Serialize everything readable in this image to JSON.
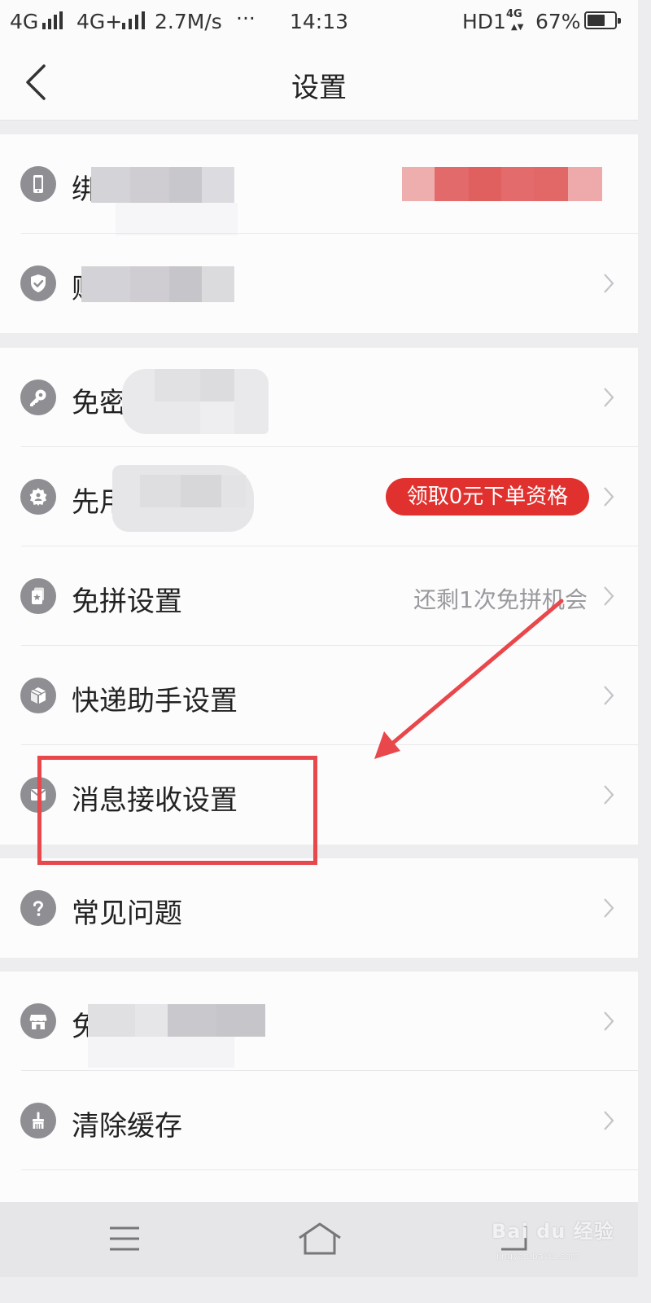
{
  "status_bar": {
    "carrier1": "4G",
    "carrier2": "4G+",
    "speed": "2.7M/s",
    "more": "···",
    "time": "14:13",
    "hd": "HD1",
    "net": "4G",
    "battery_percent": "67%",
    "battery_level": 0.67
  },
  "nav": {
    "back_icon": "chevron-left-icon",
    "title": "设置"
  },
  "groups": [
    {
      "items": [
        {
          "label": "绑",
          "icon": "phone-icon"
        },
        {
          "label": "账",
          "icon": "shield-icon"
        }
      ]
    },
    {
      "items": [
        {
          "label": "免密",
          "icon": "key-icon"
        },
        {
          "label": "先用",
          "icon": "badge-icon",
          "badge": "领取0元下单资格"
        },
        {
          "label": "免拼设置",
          "icon": "card-star-icon",
          "value": "还剩1次免拼机会"
        },
        {
          "label": "快递助手设置",
          "icon": "package-icon"
        },
        {
          "label": "消息接收设置",
          "icon": "mail-icon"
        }
      ]
    },
    {
      "items": [
        {
          "label": "常见问题",
          "icon": "question-icon"
        }
      ]
    },
    {
      "items": [
        {
          "label": "免费多",
          "icon": "store-icon"
        },
        {
          "label": "清除缓存",
          "icon": "broom-icon"
        }
      ]
    }
  ],
  "colors": {
    "accent_red": "#e0312e",
    "annotation_red": "#e8474b",
    "icon_gray": "#8e8e93"
  },
  "watermark": {
    "text": "Bai du 经验",
    "url": "jingyan.baidu.com"
  },
  "bottom_bar": {
    "menu_icon": "menu-icon",
    "home_icon": "home-icon",
    "back_icon": "back-icon"
  }
}
